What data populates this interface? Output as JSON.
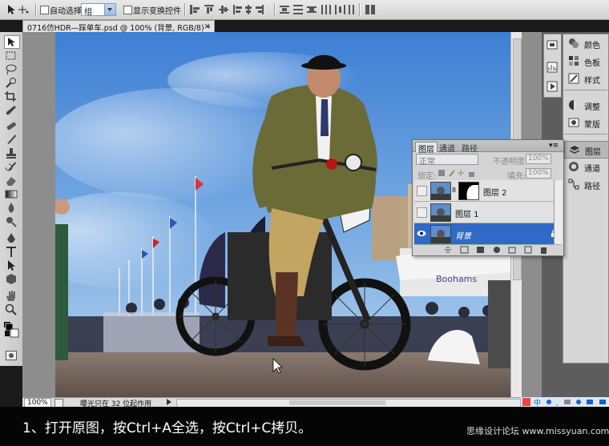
{
  "options_bar": {
    "auto_select_label": "自动选择:",
    "auto_select_value": "组",
    "show_transform_label": "显示变换控件"
  },
  "document": {
    "tab_title": "0716仿HDR—踩单车.psd @ 100% (背景, RGB/8) *",
    "close_label": "×"
  },
  "status_bar": {
    "zoom": "100%",
    "info": "曝光只在 32 位起作用"
  },
  "dock": {
    "items": [
      {
        "label": "颜色",
        "icon": "color-icon"
      },
      {
        "label": "色板",
        "icon": "swatches-icon"
      },
      {
        "label": "样式",
        "icon": "styles-icon"
      },
      {
        "label": "调整",
        "icon": "adjustments-icon"
      },
      {
        "label": "蒙版",
        "icon": "masks-icon"
      },
      {
        "label": "图层",
        "icon": "layers-icon"
      },
      {
        "label": "通道",
        "icon": "channels-icon"
      },
      {
        "label": "路径",
        "icon": "paths-icon"
      }
    ]
  },
  "layers_panel": {
    "tabs": [
      "图层",
      "通道",
      "路径"
    ],
    "blend_mode": "正常",
    "opacity_label": "不透明度:",
    "opacity_value": "100%",
    "lock_label": "锁定:",
    "fill_label": "填充:",
    "fill_value": "100%",
    "layers": [
      {
        "name": "图层 2",
        "selected": false
      },
      {
        "name": "图层 1",
        "selected": false
      },
      {
        "name": "背景",
        "selected": true
      }
    ]
  },
  "caption": "1、打开原图，按Ctrl+A全选，按Ctrl+C拷贝。",
  "watermark": "思缘设计论坛 www.missyuan.com",
  "colors": {
    "sky_top": "#3d7fd4",
    "sky_bottom": "#bcd6ee",
    "selection": "#3169c6"
  }
}
